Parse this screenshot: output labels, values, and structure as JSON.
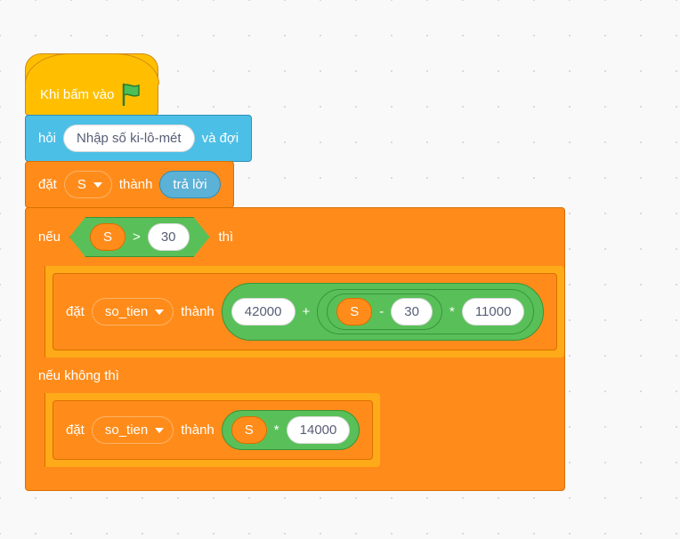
{
  "hat": {
    "label": "Khi bấm vào"
  },
  "ask": {
    "label_before": "hỏi",
    "prompt": "Nhập số ki-lô-mét",
    "label_after": "và đợi"
  },
  "set_s": {
    "label_set": "đặt",
    "var_name": "S",
    "label_to": "thành",
    "answer_label": "trả lời"
  },
  "if_block": {
    "label_if": "nếu",
    "label_then": "thì",
    "label_else": "nếu không thì",
    "condition": {
      "left_var": "S",
      "operator": ">",
      "right_value": "30"
    },
    "then_set": {
      "label_set": "đặt",
      "var_name": "so_tien",
      "label_to": "thành",
      "expr": {
        "a": "42000",
        "op1": "+",
        "inner": {
          "left_var": "S",
          "op": "-",
          "right_value": "30"
        },
        "op2": "*",
        "c": "11000"
      }
    },
    "else_set": {
      "label_set": "đặt",
      "var_name": "so_tien",
      "label_to": "thành",
      "expr": {
        "left_var": "S",
        "op": "*",
        "right_value": "14000"
      }
    }
  }
}
